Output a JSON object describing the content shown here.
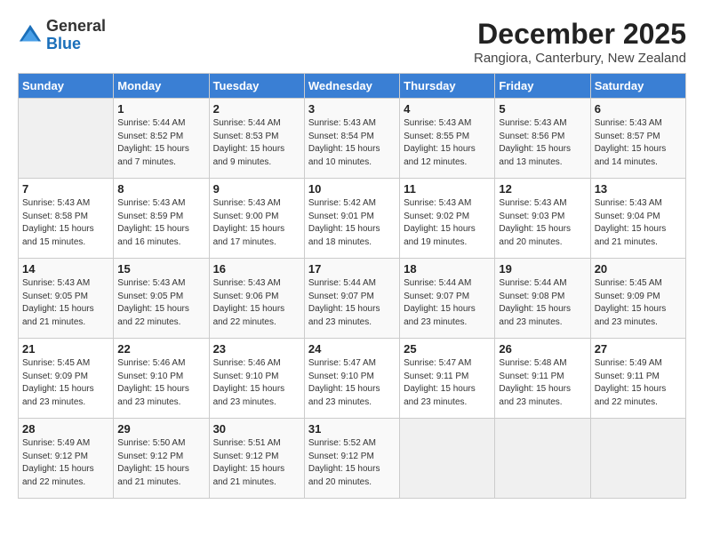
{
  "logo": {
    "general": "General",
    "blue": "Blue"
  },
  "title": "December 2025",
  "location": "Rangiora, Canterbury, New Zealand",
  "days_of_week": [
    "Sunday",
    "Monday",
    "Tuesday",
    "Wednesday",
    "Thursday",
    "Friday",
    "Saturday"
  ],
  "weeks": [
    [
      {
        "day": "",
        "sunrise": "",
        "sunset": "",
        "daylight": ""
      },
      {
        "day": "1",
        "sunrise": "Sunrise: 5:44 AM",
        "sunset": "Sunset: 8:52 PM",
        "daylight": "Daylight: 15 hours and 7 minutes."
      },
      {
        "day": "2",
        "sunrise": "Sunrise: 5:44 AM",
        "sunset": "Sunset: 8:53 PM",
        "daylight": "Daylight: 15 hours and 9 minutes."
      },
      {
        "day": "3",
        "sunrise": "Sunrise: 5:43 AM",
        "sunset": "Sunset: 8:54 PM",
        "daylight": "Daylight: 15 hours and 10 minutes."
      },
      {
        "day": "4",
        "sunrise": "Sunrise: 5:43 AM",
        "sunset": "Sunset: 8:55 PM",
        "daylight": "Daylight: 15 hours and 12 minutes."
      },
      {
        "day": "5",
        "sunrise": "Sunrise: 5:43 AM",
        "sunset": "Sunset: 8:56 PM",
        "daylight": "Daylight: 15 hours and 13 minutes."
      },
      {
        "day": "6",
        "sunrise": "Sunrise: 5:43 AM",
        "sunset": "Sunset: 8:57 PM",
        "daylight": "Daylight: 15 hours and 14 minutes."
      }
    ],
    [
      {
        "day": "7",
        "sunrise": "Sunrise: 5:43 AM",
        "sunset": "Sunset: 8:58 PM",
        "daylight": "Daylight: 15 hours and 15 minutes."
      },
      {
        "day": "8",
        "sunrise": "Sunrise: 5:43 AM",
        "sunset": "Sunset: 8:59 PM",
        "daylight": "Daylight: 15 hours and 16 minutes."
      },
      {
        "day": "9",
        "sunrise": "Sunrise: 5:43 AM",
        "sunset": "Sunset: 9:00 PM",
        "daylight": "Daylight: 15 hours and 17 minutes."
      },
      {
        "day": "10",
        "sunrise": "Sunrise: 5:42 AM",
        "sunset": "Sunset: 9:01 PM",
        "daylight": "Daylight: 15 hours and 18 minutes."
      },
      {
        "day": "11",
        "sunrise": "Sunrise: 5:43 AM",
        "sunset": "Sunset: 9:02 PM",
        "daylight": "Daylight: 15 hours and 19 minutes."
      },
      {
        "day": "12",
        "sunrise": "Sunrise: 5:43 AM",
        "sunset": "Sunset: 9:03 PM",
        "daylight": "Daylight: 15 hours and 20 minutes."
      },
      {
        "day": "13",
        "sunrise": "Sunrise: 5:43 AM",
        "sunset": "Sunset: 9:04 PM",
        "daylight": "Daylight: 15 hours and 21 minutes."
      }
    ],
    [
      {
        "day": "14",
        "sunrise": "Sunrise: 5:43 AM",
        "sunset": "Sunset: 9:05 PM",
        "daylight": "Daylight: 15 hours and 21 minutes."
      },
      {
        "day": "15",
        "sunrise": "Sunrise: 5:43 AM",
        "sunset": "Sunset: 9:05 PM",
        "daylight": "Daylight: 15 hours and 22 minutes."
      },
      {
        "day": "16",
        "sunrise": "Sunrise: 5:43 AM",
        "sunset": "Sunset: 9:06 PM",
        "daylight": "Daylight: 15 hours and 22 minutes."
      },
      {
        "day": "17",
        "sunrise": "Sunrise: 5:44 AM",
        "sunset": "Sunset: 9:07 PM",
        "daylight": "Daylight: 15 hours and 23 minutes."
      },
      {
        "day": "18",
        "sunrise": "Sunrise: 5:44 AM",
        "sunset": "Sunset: 9:07 PM",
        "daylight": "Daylight: 15 hours and 23 minutes."
      },
      {
        "day": "19",
        "sunrise": "Sunrise: 5:44 AM",
        "sunset": "Sunset: 9:08 PM",
        "daylight": "Daylight: 15 hours and 23 minutes."
      },
      {
        "day": "20",
        "sunrise": "Sunrise: 5:45 AM",
        "sunset": "Sunset: 9:09 PM",
        "daylight": "Daylight: 15 hours and 23 minutes."
      }
    ],
    [
      {
        "day": "21",
        "sunrise": "Sunrise: 5:45 AM",
        "sunset": "Sunset: 9:09 PM",
        "daylight": "Daylight: 15 hours and 23 minutes."
      },
      {
        "day": "22",
        "sunrise": "Sunrise: 5:46 AM",
        "sunset": "Sunset: 9:10 PM",
        "daylight": "Daylight: 15 hours and 23 minutes."
      },
      {
        "day": "23",
        "sunrise": "Sunrise: 5:46 AM",
        "sunset": "Sunset: 9:10 PM",
        "daylight": "Daylight: 15 hours and 23 minutes."
      },
      {
        "day": "24",
        "sunrise": "Sunrise: 5:47 AM",
        "sunset": "Sunset: 9:10 PM",
        "daylight": "Daylight: 15 hours and 23 minutes."
      },
      {
        "day": "25",
        "sunrise": "Sunrise: 5:47 AM",
        "sunset": "Sunset: 9:11 PM",
        "daylight": "Daylight: 15 hours and 23 minutes."
      },
      {
        "day": "26",
        "sunrise": "Sunrise: 5:48 AM",
        "sunset": "Sunset: 9:11 PM",
        "daylight": "Daylight: 15 hours and 23 minutes."
      },
      {
        "day": "27",
        "sunrise": "Sunrise: 5:49 AM",
        "sunset": "Sunset: 9:11 PM",
        "daylight": "Daylight: 15 hours and 22 minutes."
      }
    ],
    [
      {
        "day": "28",
        "sunrise": "Sunrise: 5:49 AM",
        "sunset": "Sunset: 9:12 PM",
        "daylight": "Daylight: 15 hours and 22 minutes."
      },
      {
        "day": "29",
        "sunrise": "Sunrise: 5:50 AM",
        "sunset": "Sunset: 9:12 PM",
        "daylight": "Daylight: 15 hours and 21 minutes."
      },
      {
        "day": "30",
        "sunrise": "Sunrise: 5:51 AM",
        "sunset": "Sunset: 9:12 PM",
        "daylight": "Daylight: 15 hours and 21 minutes."
      },
      {
        "day": "31",
        "sunrise": "Sunrise: 5:52 AM",
        "sunset": "Sunset: 9:12 PM",
        "daylight": "Daylight: 15 hours and 20 minutes."
      },
      {
        "day": "",
        "sunrise": "",
        "sunset": "",
        "daylight": ""
      },
      {
        "day": "",
        "sunrise": "",
        "sunset": "",
        "daylight": ""
      },
      {
        "day": "",
        "sunrise": "",
        "sunset": "",
        "daylight": ""
      }
    ]
  ]
}
